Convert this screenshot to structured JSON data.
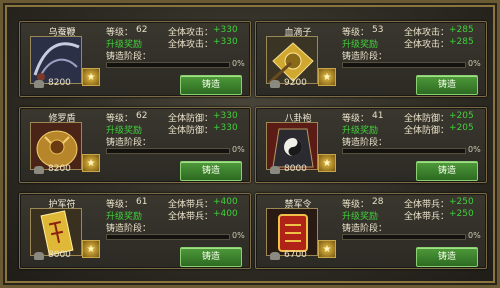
{
  "cards": [
    {
      "name": "乌蚕鞭",
      "level_label": "等级：",
      "level": "62",
      "stat1_label": "全体攻击：",
      "stat1_value": "+330",
      "stat2_label": "全体攻击：",
      "stat2_value": "+330",
      "upgrade": "升级奖励",
      "stage_label": "铸造阶段：",
      "progress_pct": "0%",
      "progress": 0,
      "cost": "8200",
      "button": "铸造",
      "icon": "whip-icon"
    },
    {
      "name": "血滴子",
      "level_label": "等级：",
      "level": "53",
      "stat1_label": "全体攻击：",
      "stat1_value": "+285",
      "stat2_label": "全体攻击：",
      "stat2_value": "+285",
      "upgrade": "升级奖励",
      "stage_label": "铸造阶段：",
      "progress_pct": "0%",
      "progress": 0,
      "cost": "9200",
      "button": "铸造",
      "icon": "xuedizi-icon"
    },
    {
      "name": "修罗盾",
      "level_label": "等级：",
      "level": "62",
      "stat1_label": "全体防御：",
      "stat1_value": "+330",
      "stat2_label": "全体防御：",
      "stat2_value": "+330",
      "upgrade": "升级奖励",
      "stage_label": "铸造阶段：",
      "progress_pct": "0%",
      "progress": 0,
      "cost": "8200",
      "button": "铸造",
      "icon": "shield-icon"
    },
    {
      "name": "八卦袍",
      "level_label": "等级：",
      "level": "41",
      "stat1_label": "全体防御：",
      "stat1_value": "+205",
      "stat2_label": "全体防御：",
      "stat2_value": "+205",
      "upgrade": "升级奖励",
      "stage_label": "铸造阶段：",
      "progress_pct": "0%",
      "progress": 0,
      "cost": "8000",
      "button": "铸造",
      "icon": "bagua-robe-icon"
    },
    {
      "name": "护军符",
      "level_label": "等级：",
      "level": "61",
      "stat1_label": "全体带兵：",
      "stat1_value": "+400",
      "stat2_label": "全体带兵：",
      "stat2_value": "+400",
      "upgrade": "升级奖励",
      "stage_label": "铸造阶段：",
      "progress_pct": "0%",
      "progress": 0,
      "cost": "8000",
      "button": "铸造",
      "icon": "talisman-icon"
    },
    {
      "name": "禁军令",
      "level_label": "等级：",
      "level": "28",
      "stat1_label": "全体带兵：",
      "stat1_value": "+250",
      "stat2_label": "全体带兵：",
      "stat2_value": "+250",
      "upgrade": "升级奖励",
      "stage_label": "铸造阶段：",
      "progress_pct": "0%",
      "progress": 0,
      "cost": "6700",
      "button": "铸造",
      "icon": "command-token-icon"
    }
  ]
}
